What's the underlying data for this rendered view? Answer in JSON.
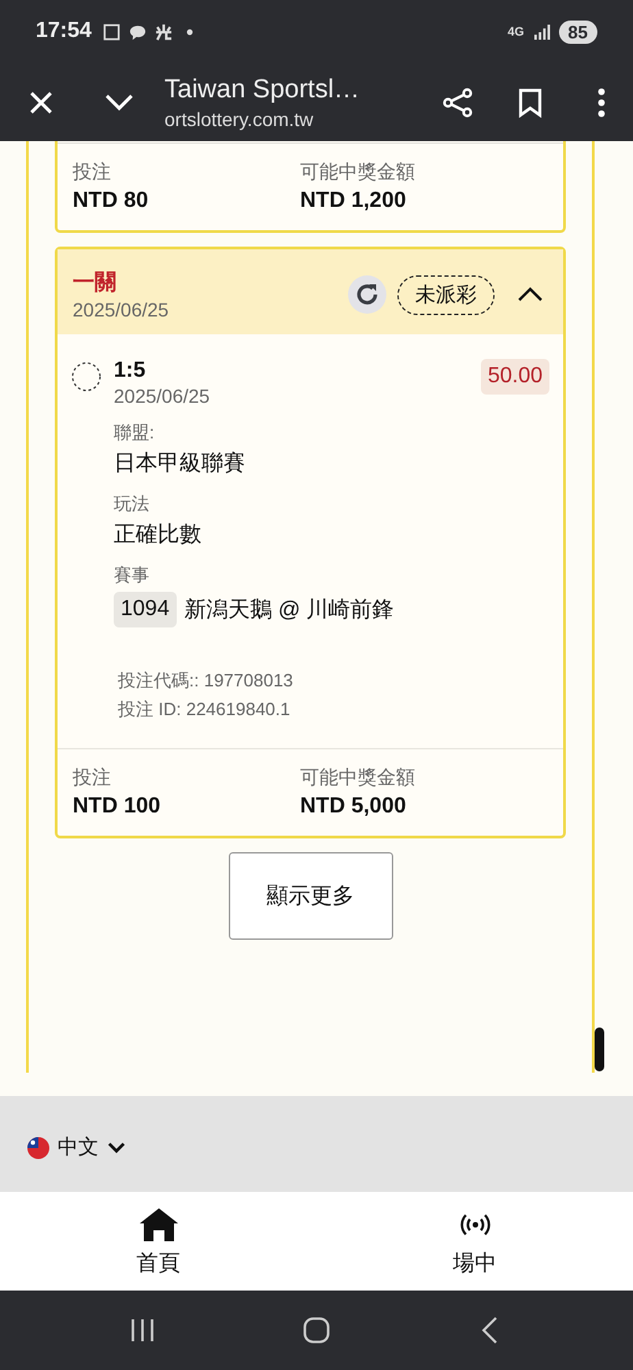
{
  "status_bar": {
    "time": "17:54",
    "network": "4G",
    "battery": "85"
  },
  "browser": {
    "title": "Taiwan Sportsl…",
    "url": "ortslottery.com.tw"
  },
  "bets": [
    {
      "partial": true,
      "stake_label": "投注",
      "stake": "NTD 80",
      "payout_label": "可能中獎金額",
      "payout": "NTD 1,200"
    },
    {
      "partial": false,
      "title": "一關",
      "date": "2025/06/25",
      "status": "未派彩",
      "expanded": true,
      "selection": {
        "pick": "1:5",
        "date": "2025/06/25",
        "odds": "50.00",
        "league_label": "聯盟:",
        "league": "日本甲級聯賽",
        "market_label": "玩法",
        "market": "正確比數",
        "event_label": "賽事",
        "event_no": "1094",
        "event": "新潟天鵝 @ 川崎前鋒",
        "bet_code": "投注代碼:: 197708013",
        "bet_id": "投注 ID: 224619840.1"
      },
      "stake_label": "投注",
      "stake": "NTD 100",
      "payout_label": "可能中獎金額",
      "payout": "NTD 5,000"
    }
  ],
  "show_more": "顯示更多",
  "language": "中文",
  "nav": [
    {
      "kind": "home",
      "label": "首頁"
    },
    {
      "kind": "live",
      "label": "場中"
    }
  ]
}
